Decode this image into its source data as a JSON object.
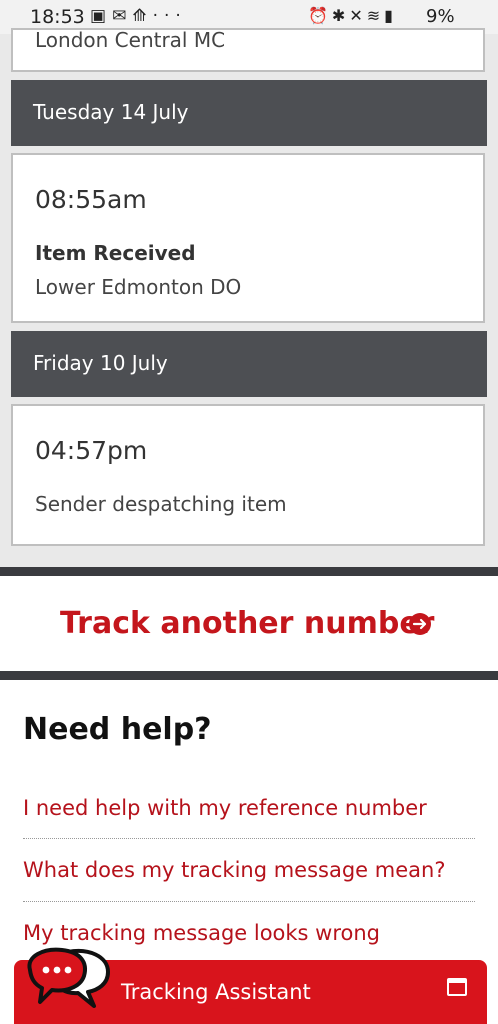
{
  "status_bar": {
    "time": "18:53",
    "left_icons": [
      "image-icon",
      "mail-icon",
      "arrow-icon",
      "more-icon"
    ],
    "right_icons": [
      "alarm-icon",
      "bluetooth-icon",
      "mute-icon",
      "wifi-icon",
      "signal-icon"
    ],
    "battery": "9%"
  },
  "timeline": {
    "top_card_text": "London Central MC",
    "entries": [
      {
        "date": "Tuesday 14 July",
        "time": "08:55am",
        "status": "Item Received",
        "location": "Lower Edmonton DO"
      },
      {
        "date": "Friday 10 July",
        "time": "04:57pm",
        "status": "",
        "location": "Sender despatching item"
      }
    ]
  },
  "track_another": {
    "label": "Track another number",
    "icon": "arrow-circle-icon"
  },
  "help": {
    "title": "Need help?",
    "links": [
      "I need help with my reference number",
      "What does my tracking message mean?",
      "My tracking message looks wrong"
    ]
  },
  "assistant": {
    "label": "Tracking Assistant",
    "icon": "chat-bubbles-icon",
    "window_icon": "window-icon"
  },
  "colors": {
    "accent_red": "#d8141c",
    "header_gray": "#4d4f53",
    "link_red": "#b5121b"
  }
}
